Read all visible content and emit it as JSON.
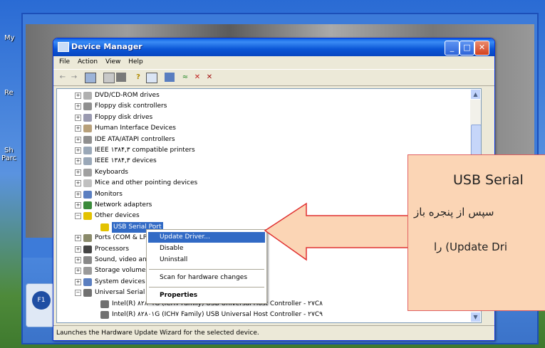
{
  "desktop": {
    "labels": [
      "My",
      "Re",
      "Sh",
      "Parc"
    ],
    "icon_caption": "F1"
  },
  "window": {
    "title": "Device Manager",
    "menu": [
      "File",
      "Action",
      "View",
      "Help"
    ]
  },
  "tree": [
    {
      "label": "DVD/CD-ROM drives",
      "expand": "+",
      "icon": "dvd-drive-icon",
      "color": "#b0b0b0"
    },
    {
      "label": "Floppy disk controllers",
      "expand": "+",
      "icon": "floppy-controller-icon",
      "color": "#8f8f8f"
    },
    {
      "label": "Floppy disk drives",
      "expand": "+",
      "icon": "floppy-drive-icon",
      "color": "#9a9ab0"
    },
    {
      "label": "Human Interface Devices",
      "expand": "+",
      "icon": "hid-icon",
      "color": "#b8a07a"
    },
    {
      "label": "IDE ATA/ATAPI controllers",
      "expand": "+",
      "icon": "ide-controller-icon",
      "color": "#8f8f8f"
    },
    {
      "label": "IEEE ۱۳۸۴,۳ compatible printers",
      "expand": "+",
      "icon": "printer-icon",
      "color": "#9aa8b8"
    },
    {
      "label": "IEEE ۱۳۸۴,۳ devices",
      "expand": "+",
      "icon": "ieee-device-icon",
      "color": "#9aa8b8"
    },
    {
      "label": "Keyboards",
      "expand": "+",
      "icon": "keyboard-icon",
      "color": "#a0a0a0"
    },
    {
      "label": "Mice and other pointing devices",
      "expand": "+",
      "icon": "mouse-icon",
      "color": "#c0c0c0"
    },
    {
      "label": "Monitors",
      "expand": "+",
      "icon": "monitor-icon",
      "color": "#5a7ec0"
    },
    {
      "label": "Network adapters",
      "expand": "+",
      "icon": "network-adapter-icon",
      "color": "#3a8a3a"
    },
    {
      "label": "Other devices",
      "expand": "−",
      "icon": "unknown-device-icon",
      "color": "#e3c200"
    },
    {
      "label": "USB Serial Port",
      "expand": "",
      "icon": "usb-serial-warning-icon",
      "color": "#e3c200",
      "indent": 1,
      "selected": true
    },
    {
      "label": "Ports (COM & LPT)",
      "expand": "+",
      "icon": "port-icon",
      "color": "#8a8a6a"
    },
    {
      "label": "Processors",
      "expand": "+",
      "icon": "processor-icon",
      "color": "#444444"
    },
    {
      "label": "Sound, video and game controllers",
      "expand": "+",
      "icon": "sound-icon",
      "color": "#888888"
    },
    {
      "label": "Storage volumes",
      "expand": "+",
      "icon": "storage-icon",
      "color": "#9a9a9a"
    },
    {
      "label": "System devices",
      "expand": "+",
      "icon": "system-device-icon",
      "color": "#5a7ec0"
    },
    {
      "label": "Universal Serial Bus controllers",
      "expand": "−",
      "icon": "usb-controller-icon",
      "color": "#707070"
    },
    {
      "label": "Intel(R) ۸۲۸۰۱G (ICH۷ Family) USB Universal Host Controller - ۲۷C۸",
      "expand": "",
      "icon": "usb-controller-icon",
      "color": "#707070",
      "indent": 1
    },
    {
      "label": "Intel(R) ۸۲۸۰۱G (ICH۷ Family) USB Universal Host Controller - ۲۷C۹",
      "expand": "",
      "icon": "usb-controller-icon",
      "color": "#707070",
      "indent": 1
    }
  ],
  "context_menu": {
    "update_driver": "Update Driver...",
    "disable": "Disable",
    "uninstall": "Uninstall",
    "scan": "Scan for hardware changes",
    "properties": "Properties"
  },
  "status": "Launches the Hardware Update Wizard for the selected device.",
  "callout": {
    "line1": "USB Serial",
    "line2": "سپس از پنجره باز",
    "line3": "(Update Dri",
    "line3_suffix": "را"
  },
  "colors": {
    "selection": "#316ac5",
    "callout_fill": "#fbd5b5",
    "callout_border": "#e06060",
    "title_blue": "#0a5fe5"
  }
}
